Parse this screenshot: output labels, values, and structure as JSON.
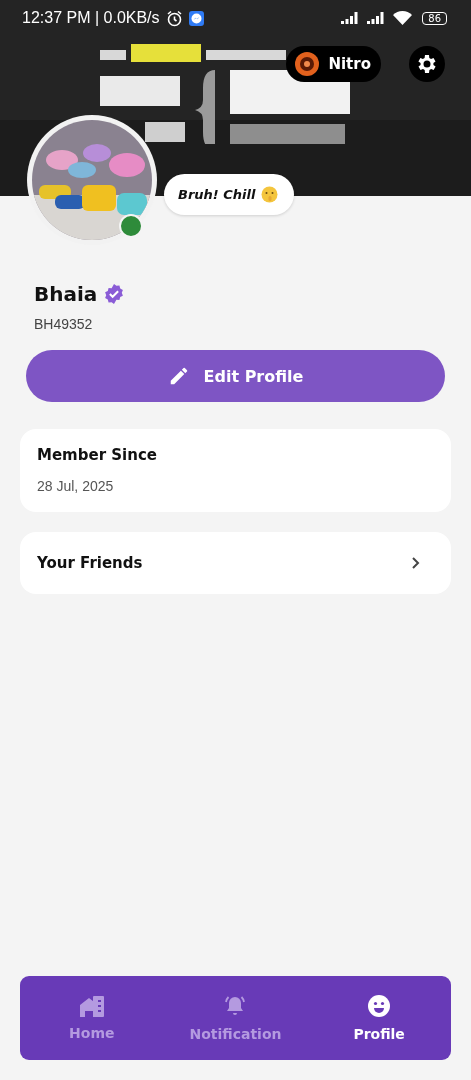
{
  "status_bar": {
    "time": "12:37 PM | 0.0KB/s",
    "battery": "86"
  },
  "header": {
    "nitro": {
      "label": "Nitro"
    }
  },
  "profile": {
    "online": true,
    "status": "Bruh! Chill",
    "name": "Bhaia",
    "verified": true,
    "id": "BH49352"
  },
  "edit_button": {
    "label": "Edit Profile"
  },
  "member_card": {
    "title": "Member Since",
    "date": "28 Jul, 2025"
  },
  "friends_row": {
    "label": "Your Friends"
  },
  "bottom_nav": [
    {
      "kind": "home",
      "label": "Home",
      "selected": false
    },
    {
      "kind": "bell",
      "label": "Notification",
      "selected": false
    },
    {
      "kind": "smile",
      "label": "Profile",
      "selected": true
    }
  ]
}
